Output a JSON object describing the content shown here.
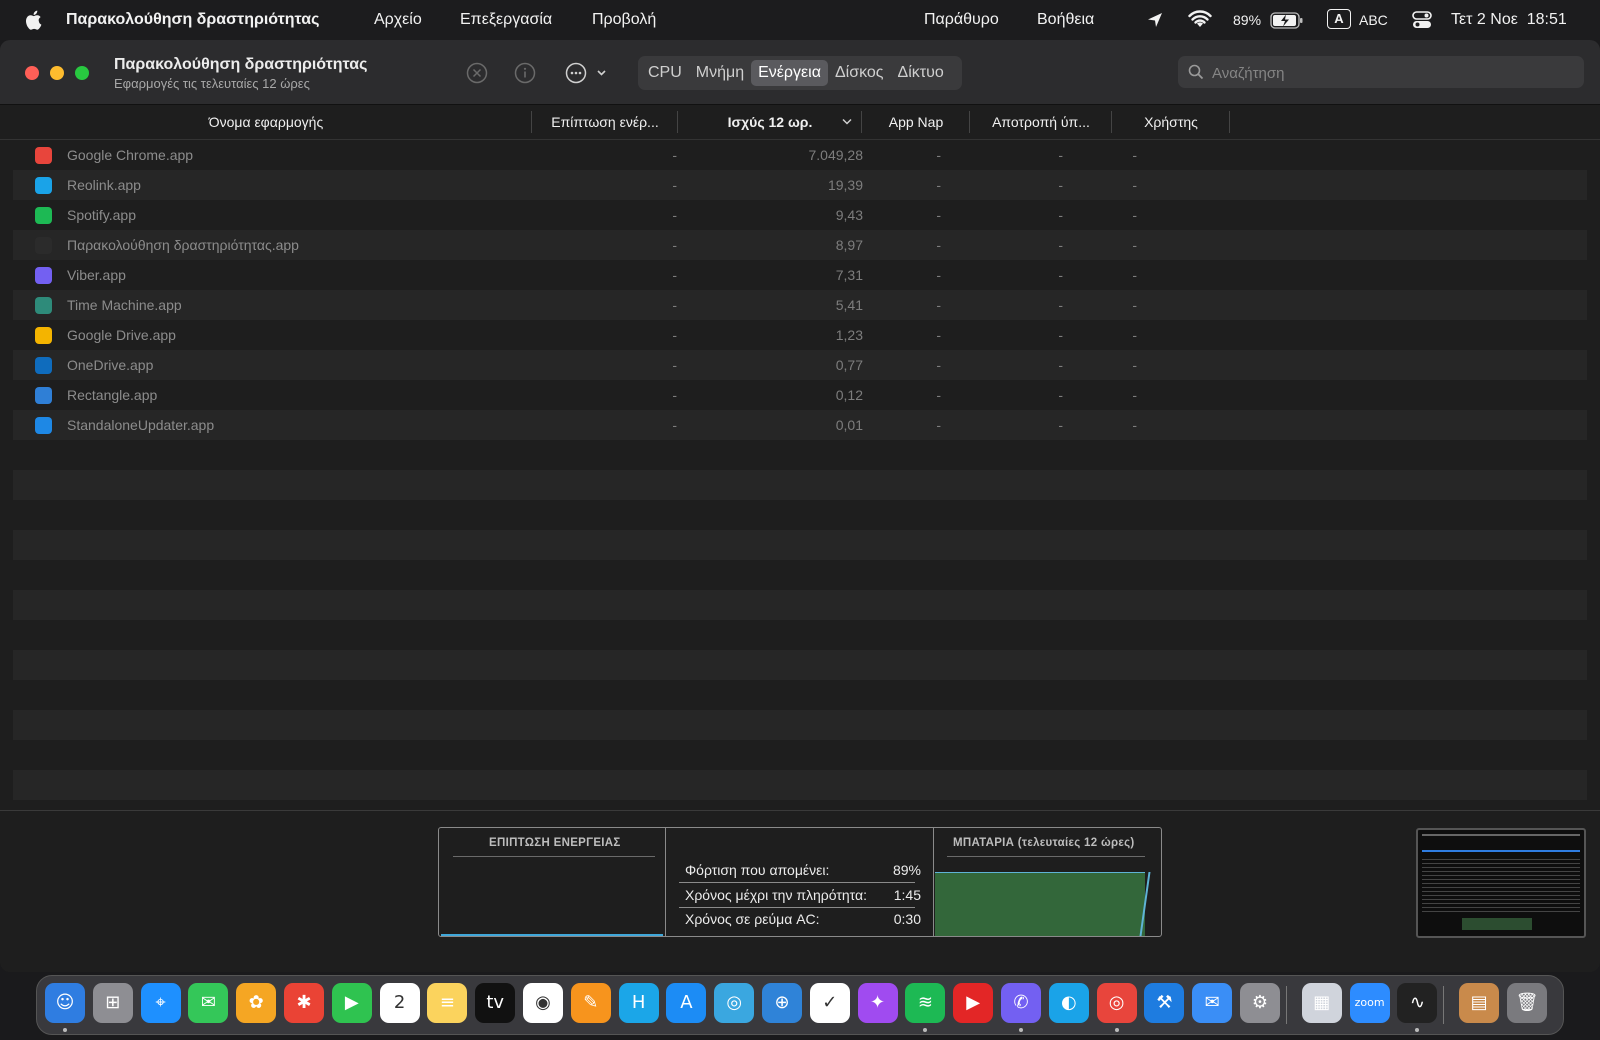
{
  "menubar": {
    "app_name": "Παρακολούθηση δραστηριότητας",
    "items": [
      "Αρχείο",
      "Επεξεργασία",
      "Προβολή"
    ],
    "right_items": [
      "Παράθυρο",
      "Βοήθεια"
    ],
    "battery_percent": "89%",
    "input_source": "ABC",
    "input_letter": "A",
    "datetime": "Τετ 2 Νοε  18:51"
  },
  "window": {
    "title": "Παρακολούθηση δραστηριότητας",
    "subtitle": "Εφαρμογές τις τελευταίες 12 ώρες",
    "tabs": [
      "CPU",
      "Μνήμη",
      "Ενέργεια",
      "Δίσκος",
      "Δίκτυο"
    ],
    "active_tab": "Ενέργεια",
    "search_placeholder": "Αναζήτηση"
  },
  "table": {
    "columns": [
      "Όνομα εφαρμογής",
      "Επίπτωση ενέρ...",
      "Ισχύς 12 ωρ.",
      "App Nap",
      "Αποτροπή ύπ...",
      "Χρήστης"
    ],
    "sorted_column": "Ισχύς 12 ωρ.",
    "rows": [
      {
        "name": "Google Chrome.app",
        "impact": "-",
        "power12h": "7.049,28",
        "app_nap": "-",
        "prevent_sleep": "-",
        "user": "-",
        "icon": "chrome-icon",
        "icon_color": "#e8453c"
      },
      {
        "name": "Reolink.app",
        "impact": "-",
        "power12h": "19,39",
        "app_nap": "-",
        "prevent_sleep": "-",
        "user": "-",
        "icon": "reolink-icon",
        "icon_color": "#1aa3e8"
      },
      {
        "name": "Spotify.app",
        "impact": "-",
        "power12h": "9,43",
        "app_nap": "-",
        "prevent_sleep": "-",
        "user": "-",
        "icon": "spotify-icon",
        "icon_color": "#1db954"
      },
      {
        "name": "Παρακολούθηση δραστηριότητας.app",
        "impact": "-",
        "power12h": "8,97",
        "app_nap": "-",
        "prevent_sleep": "-",
        "user": "-",
        "icon": "activity-monitor-icon",
        "icon_color": "#2b2b2b"
      },
      {
        "name": "Viber.app",
        "impact": "-",
        "power12h": "7,31",
        "app_nap": "-",
        "prevent_sleep": "-",
        "user": "-",
        "icon": "viber-icon",
        "icon_color": "#7360f2"
      },
      {
        "name": "Time Machine.app",
        "impact": "-",
        "power12h": "5,41",
        "app_nap": "-",
        "prevent_sleep": "-",
        "user": "-",
        "icon": "time-machine-icon",
        "icon_color": "#2e8b7a"
      },
      {
        "name": "Google Drive.app",
        "impact": "-",
        "power12h": "1,23",
        "app_nap": "-",
        "prevent_sleep": "-",
        "user": "-",
        "icon": "google-drive-icon",
        "icon_color": "#f4b400"
      },
      {
        "name": "OneDrive.app",
        "impact": "-",
        "power12h": "0,77",
        "app_nap": "-",
        "prevent_sleep": "-",
        "user": "-",
        "icon": "onedrive-icon",
        "icon_color": "#0f6cbd"
      },
      {
        "name": "Rectangle.app",
        "impact": "-",
        "power12h": "0,12",
        "app_nap": "-",
        "prevent_sleep": "-",
        "user": "-",
        "icon": "rectangle-icon",
        "icon_color": "#2f7fd6"
      },
      {
        "name": "StandaloneUpdater.app",
        "impact": "-",
        "power12h": "0,01",
        "app_nap": "-",
        "prevent_sleep": "-",
        "user": "-",
        "icon": "onedrive-updater-icon",
        "icon_color": "#1e88e5"
      }
    ]
  },
  "bottom_panel": {
    "energy_impact_title": "ΕΠΙΠΤΩΣΗ ΕΝΕΡΓΕΙΑΣ",
    "battery_title": "ΜΠΑΤΑΡΙΑ (τελευταίες 12 ώρες)",
    "stats": [
      {
        "label": "Φόρτιση που απομένει:",
        "value": "89%"
      },
      {
        "label": "Χρόνος μέχρι την πληρότητα:",
        "value": "1:45"
      },
      {
        "label": "Χρόνος σε ρεύμα AC:",
        "value": "0:30"
      }
    ],
    "battery_level": 0.89
  },
  "dock": {
    "apps": [
      {
        "name": "finder-icon",
        "color": "#2f7de1",
        "glyph": "☺",
        "running": true
      },
      {
        "name": "launchpad-icon",
        "color": "#8e8e93",
        "glyph": "⊞",
        "running": false
      },
      {
        "name": "safari-icon",
        "color": "#1e90ff",
        "glyph": "⌖",
        "running": false
      },
      {
        "name": "messages-icon",
        "color": "#34c759",
        "glyph": "✉",
        "running": false
      },
      {
        "name": "photos-icon",
        "color": "#f5a623",
        "glyph": "✿",
        "running": false
      },
      {
        "name": "google-photos-icon",
        "color": "#ea4335",
        "glyph": "✱",
        "running": false
      },
      {
        "name": "facetime-icon",
        "color": "#2fc350",
        "glyph": "▶",
        "running": false
      },
      {
        "name": "calendar-icon",
        "color": "#ffffff",
        "glyph": "2",
        "running": false
      },
      {
        "name": "notes-icon",
        "color": "#fbd35d",
        "glyph": "≡",
        "running": false
      },
      {
        "name": "apple-tv-icon",
        "color": "#111111",
        "glyph": "tv",
        "running": false
      },
      {
        "name": "google-maps-icon",
        "color": "#ffffff",
        "glyph": "◉",
        "running": false
      },
      {
        "name": "pages-icon",
        "color": "#f7941d",
        "glyph": "✎",
        "running": false
      },
      {
        "name": "harmony-icon",
        "color": "#1ba6e8",
        "glyph": "H",
        "running": false
      },
      {
        "name": "app-store-icon",
        "color": "#1c8cf5",
        "glyph": "A",
        "running": false
      },
      {
        "name": "reolink-dock-icon",
        "color": "#3aa7e0",
        "glyph": "◎",
        "running": false
      },
      {
        "name": "zoom-it-icon",
        "color": "#2f83d8",
        "glyph": "⊕",
        "running": false
      },
      {
        "name": "tasks-icon",
        "color": "#ffffff",
        "glyph": "✓",
        "running": false
      },
      {
        "name": "messenger-icon",
        "color": "#a04bf0",
        "glyph": "✦",
        "running": false
      },
      {
        "name": "spotify-dock-icon",
        "color": "#1db954",
        "glyph": "≋",
        "running": true
      },
      {
        "name": "youtube-music-icon",
        "color": "#e32626",
        "glyph": "▶",
        "running": false
      },
      {
        "name": "viber-dock-icon",
        "color": "#7360f2",
        "glyph": "✆",
        "running": true
      },
      {
        "name": "reolink-client-icon",
        "color": "#1aa3e8",
        "glyph": "◐",
        "running": false
      },
      {
        "name": "chrome-dock-icon",
        "color": "#e8453c",
        "glyph": "◎",
        "running": true
      },
      {
        "name": "xcode-icon",
        "color": "#1e7ce0",
        "glyph": "⚒",
        "running": false
      },
      {
        "name": "mail-icon",
        "color": "#3a8ef6",
        "glyph": "✉",
        "running": false
      },
      {
        "name": "system-settings-icon",
        "color": "#8e8e93",
        "glyph": "⚙",
        "running": false
      },
      {
        "name": "preview-icon",
        "color": "#d0d4dc",
        "glyph": "▦",
        "running": false
      },
      {
        "name": "zoom-icon",
        "color": "#2d8cff",
        "glyph": "zoom",
        "running": false
      },
      {
        "name": "activity-monitor-dock-icon",
        "color": "#222222",
        "glyph": "∿",
        "running": true
      },
      {
        "name": "documents-stack-icon",
        "color": "#c98a4b",
        "glyph": "▤",
        "running": false
      },
      {
        "name": "trash-icon",
        "color": "#7a7a7e",
        "glyph": "🗑",
        "running": false
      }
    ]
  }
}
